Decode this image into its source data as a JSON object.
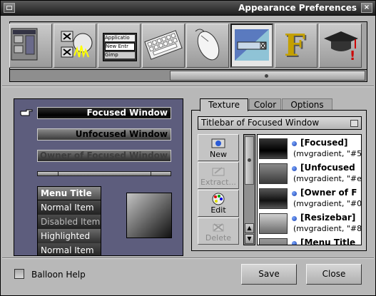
{
  "window": {
    "title": "Appearance Preferences",
    "close_glyph": "×"
  },
  "iconbar": {
    "items": [
      {
        "name": "workspace-icon",
        "tooltip": ""
      },
      {
        "name": "effects-icon",
        "tooltip": ""
      },
      {
        "name": "menu-icon",
        "label1": "Applicatio",
        "label2": "New Entr",
        "label3": "Gimp"
      },
      {
        "name": "keyboard-icon"
      },
      {
        "name": "mouse-icon"
      },
      {
        "name": "appearance-icon"
      },
      {
        "name": "font-icon",
        "glyph": "F"
      },
      {
        "name": "expert-icon",
        "glyph": "!"
      }
    ],
    "selected_index": 5
  },
  "preview": {
    "focused": "Focused Window",
    "unfocused": "Unfocused Window",
    "owner": "Owner of Focused Window",
    "menu_title": "Menu Title",
    "menu_items": [
      "Normal Item",
      "Disabled Item",
      "Highlighted",
      "Normal Item"
    ]
  },
  "tabs": [
    {
      "label": "Texture",
      "active": true
    },
    {
      "label": "Color",
      "active": false
    },
    {
      "label": "Options",
      "active": false
    }
  ],
  "texture": {
    "dropdown_value": "Titlebar of Focused Window",
    "tools": [
      {
        "label": "New",
        "enabled": true
      },
      {
        "label": "Extract...",
        "enabled": false
      },
      {
        "label": "Edit",
        "enabled": true
      },
      {
        "label": "Delete",
        "enabled": false
      }
    ],
    "list": [
      {
        "title": "[Focused]",
        "desc": "(mvgradient, \"#5"
      },
      {
        "title": "[Unfocused",
        "desc": "(mvgradient, \"#e"
      },
      {
        "title": "[Owner of F",
        "desc": "(mvgradient, \"#0"
      },
      {
        "title": "[Resizebar]",
        "desc": "(mvgradient, \"#8"
      },
      {
        "title": "[Menu Title",
        "desc": ""
      }
    ]
  },
  "footer": {
    "balloon_help": "Balloon Help",
    "save": "Save",
    "close": "Close"
  },
  "colors": {
    "accent": "#5d5d7d",
    "bullet": "#1a3fa8"
  }
}
